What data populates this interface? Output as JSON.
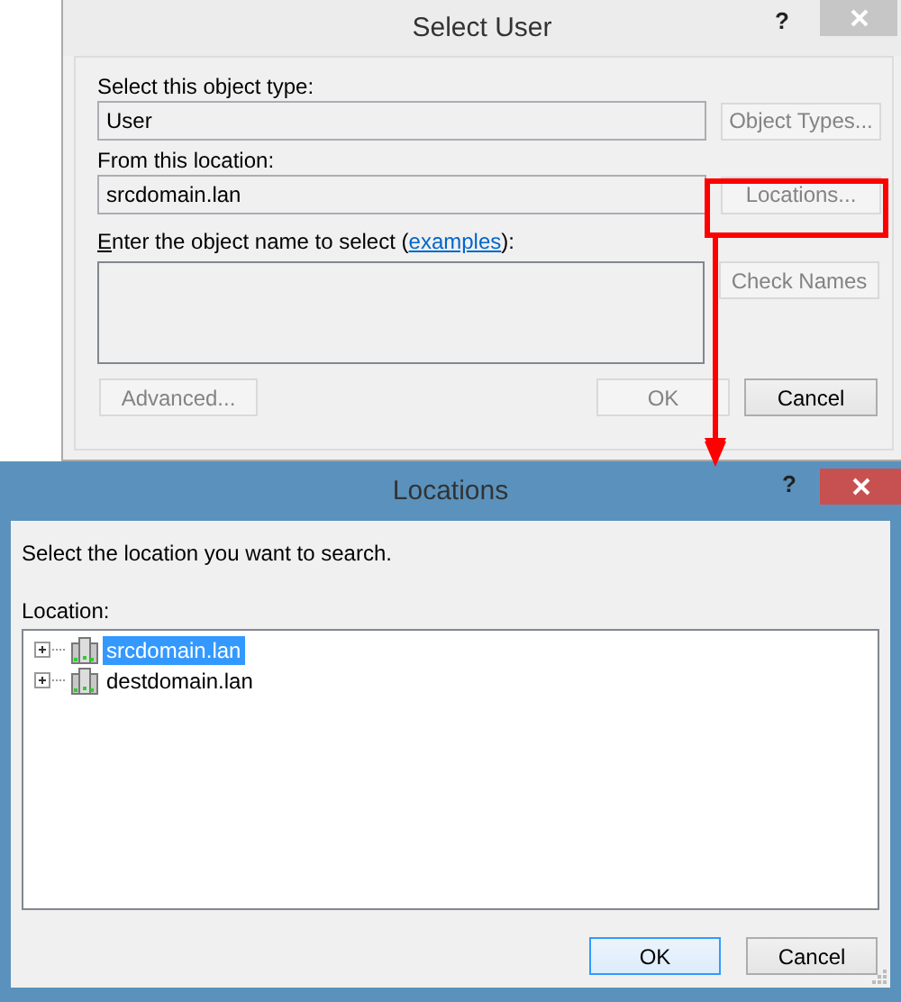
{
  "select_user_dialog": {
    "title": "Select User",
    "help": "?",
    "active": false,
    "object_type": {
      "label": "Select this object type:",
      "value": "User",
      "button": {
        "label": "Object Types...",
        "disabled": true
      }
    },
    "location": {
      "label": "From this location:",
      "value": "srcdomain.lan",
      "button": {
        "label": "Locations...",
        "disabled": true
      }
    },
    "object_name": {
      "label_before": "Enter the object name to select (",
      "link": "examples",
      "label_after": "):",
      "button": {
        "label": "Check Names",
        "disabled": true
      }
    },
    "buttons": [
      {
        "label": "Advanced...",
        "disabled": true
      },
      {
        "label": "OK",
        "disabled": true
      },
      {
        "label": "Cancel",
        "disabled": false
      }
    ]
  },
  "locations_dialog": {
    "title": "Locations",
    "help": "?",
    "active": true,
    "prompt": "Select the location you want to search.",
    "tree_label": "Location:",
    "tree": [
      {
        "label": "srcdomain.lan",
        "selected": true,
        "expanded": false
      },
      {
        "label": "destdomain.lan",
        "selected": false,
        "expanded": false
      }
    ],
    "buttons": [
      {
        "label": "OK",
        "disabled": false,
        "default": true
      },
      {
        "label": "Cancel",
        "disabled": false,
        "default": false
      }
    ]
  }
}
